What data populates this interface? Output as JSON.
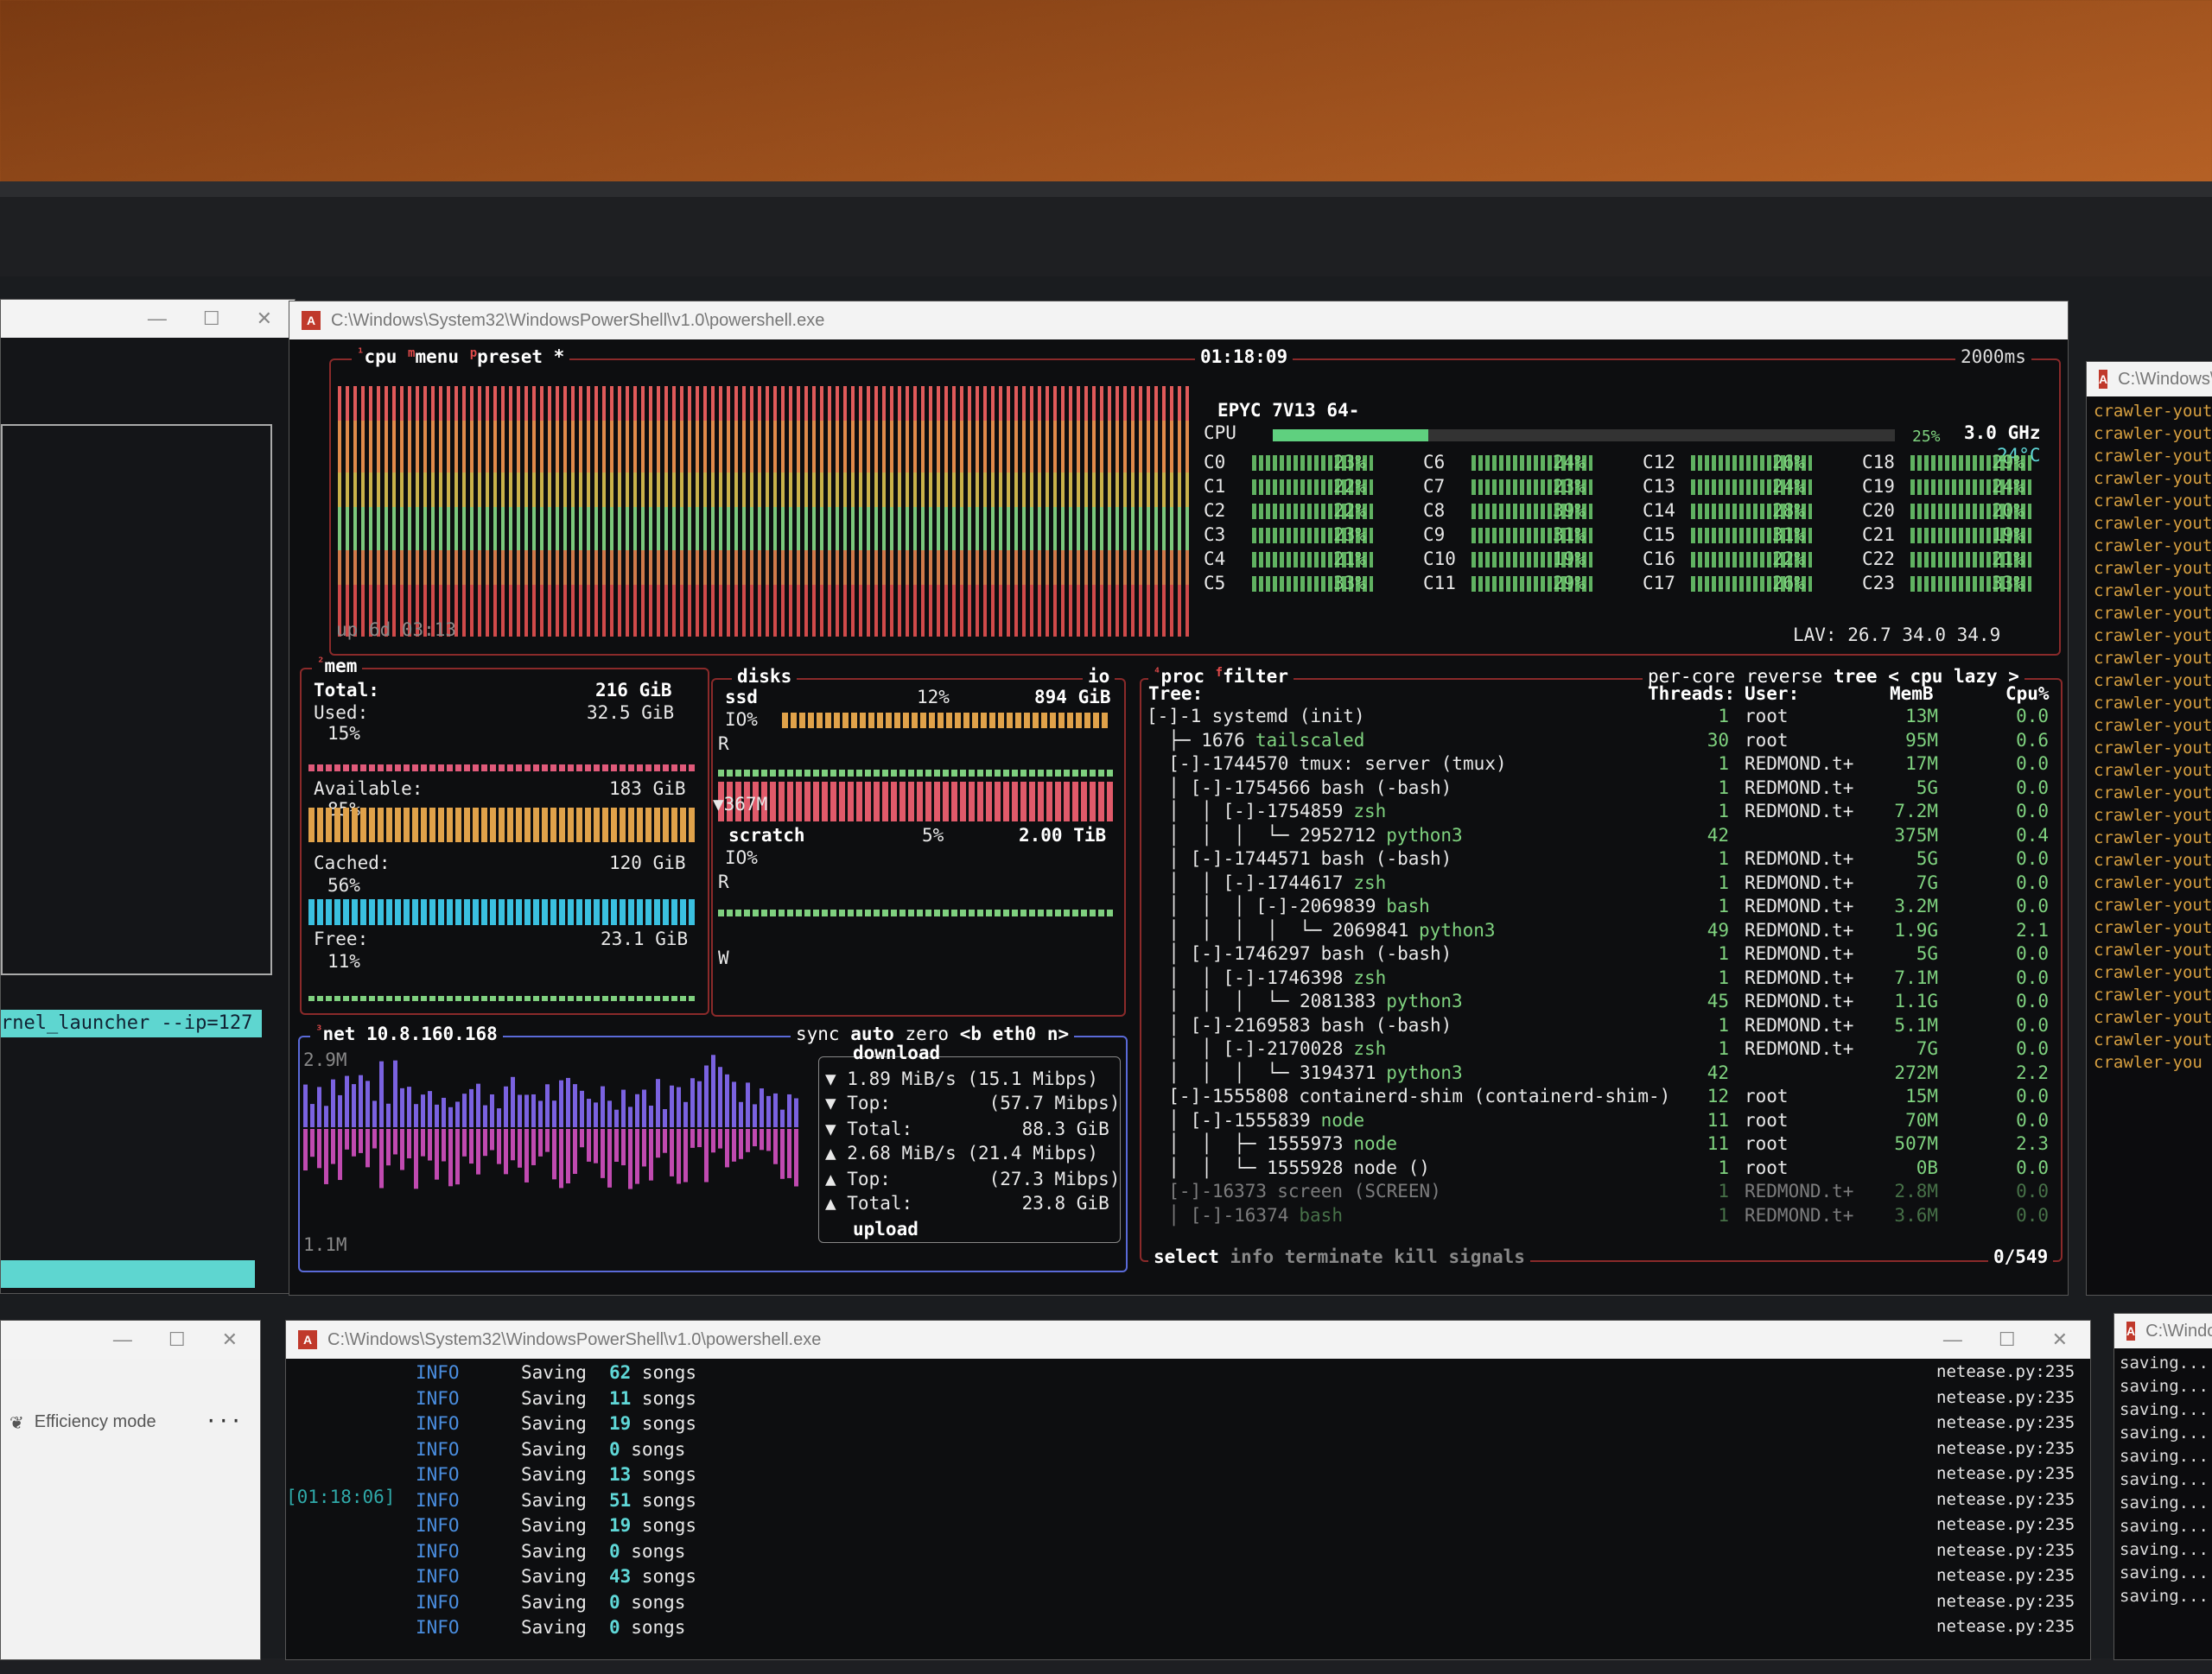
{
  "btop_window": {
    "title": "C:\\Windows\\System32\\WindowsPowerShell\\v1.0\\powershell.exe",
    "cpu_box": {
      "label": "cpu",
      "menu": "menu",
      "preset": "preset *",
      "clock": "01:18:09",
      "interval": "2000ms",
      "uptime": "up 6d 03:13",
      "model": "EPYC 7V13 64-",
      "cpu_label": "CPU",
      "total_pct": "25%",
      "freq": "3.0 GHz",
      "temp": "24°C",
      "cores": [
        {
          "n": "C0",
          "p": "23%"
        },
        {
          "n": "C1",
          "p": "22%"
        },
        {
          "n": "C2",
          "p": "22%"
        },
        {
          "n": "C3",
          "p": "23%"
        },
        {
          "n": "C4",
          "p": "21%"
        },
        {
          "n": "C5",
          "p": "33%"
        },
        {
          "n": "C6",
          "p": "24%"
        },
        {
          "n": "C7",
          "p": "23%"
        },
        {
          "n": "C8",
          "p": "39%"
        },
        {
          "n": "C9",
          "p": "31%"
        },
        {
          "n": "C10",
          "p": "19%"
        },
        {
          "n": "C11",
          "p": "29%"
        },
        {
          "n": "C12",
          "p": "26%"
        },
        {
          "n": "C13",
          "p": "24%"
        },
        {
          "n": "C14",
          "p": "28%"
        },
        {
          "n": "C15",
          "p": "31%"
        },
        {
          "n": "C16",
          "p": "22%"
        },
        {
          "n": "C17",
          "p": "26%"
        },
        {
          "n": "C18",
          "p": "29%"
        },
        {
          "n": "C19",
          "p": "24%"
        },
        {
          "n": "C20",
          "p": "20%"
        },
        {
          "n": "C21",
          "p": "19%"
        },
        {
          "n": "C22",
          "p": "21%"
        },
        {
          "n": "C23",
          "p": "33%"
        }
      ],
      "lav": "LAV: 26.7 34.0 34.9"
    },
    "mem_box": {
      "label": "mem",
      "total_l": "Total:",
      "total": "216 GiB",
      "used_l": "Used:",
      "used": "32.5 GiB",
      "used_pct": "15%",
      "avail_l": "Available:",
      "avail": "183 GiB",
      "avail_pct": "85%",
      "cached_l": "Cached:",
      "cached": "120 GiB",
      "cached_pct": "56%",
      "free_l": "Free:",
      "free": "23.1 GiB",
      "free_pct": "11%"
    },
    "disks_box": {
      "label": "disks",
      "io": "io",
      "ssd": "ssd",
      "ssd_pct": "12%",
      "ssd_size": "894 GiB",
      "io_l": "IO%",
      "r": "R",
      "ssd_note": "▼367M",
      "scratch": "scratch",
      "scratch_pct": "5%",
      "scratch_size": "2.00 TiB",
      "w": "W"
    },
    "net_box": {
      "label": "net",
      "ip": "10.8.160.168",
      "sync": "sync",
      "auto": "auto",
      "zero": "zero",
      "iface": "<b eth0 n>",
      "top_scale": "2.9M",
      "bot_scale": "1.1M",
      "download": "download",
      "dl_rate": "▼ 1.89 MiB/s (15.1 Mibps)",
      "dl_top": "▼ Top:         (57.7 Mibps)",
      "dl_total": "▼ Total:          88.3 GiB",
      "ul_rate": "▲ 2.68 MiB/s (21.4 Mibps)",
      "ul_top": "▲ Top:         (27.3 Mibps)",
      "ul_total": "▲ Total:          23.8 GiB",
      "upload": "upload"
    },
    "proc_box": {
      "label": "proc",
      "filter": "filter",
      "per_core": "per-core",
      "reverse": "reverse",
      "tree": "tree",
      "sort": "< cpu lazy >",
      "tree_hdr": "Tree:",
      "threads_hdr": "Threads:",
      "user_hdr": "User:",
      "mem_hdr": "MemB",
      "cpu_hdr": "Cpu%",
      "rows": [
        {
          "tree": "[-]-1 ",
          "name": "systemd (init)",
          "th": "1",
          "user": "root",
          "mem": "13M",
          "cpu": "0.0"
        },
        {
          "tree": "  ├─ 1676 ",
          "name": "tailscaled",
          "th": "30",
          "user": "root",
          "mem": "95M",
          "cpu": "0.6"
        },
        {
          "tree": "  [-]-1744570 ",
          "name": "tmux: server (tmux)",
          "th": "1",
          "user": "REDMOND.t+",
          "mem": "17M",
          "cpu": "0.0"
        },
        {
          "tree": "  │ [-]-1754566 ",
          "name": "bash (-bash)",
          "th": "1",
          "user": "REDMOND.t+",
          "mem": "5G",
          "cpu": "0.0"
        },
        {
          "tree": "  │  │ [-]-1754859 ",
          "name": "zsh",
          "th": "1",
          "user": "REDMOND.t+",
          "mem": "7.2M",
          "cpu": "0.0"
        },
        {
          "tree": "  │  │  │  └─ 2952712 ",
          "name": "python3",
          "th": "42",
          "user": "",
          "mem": "375M",
          "cpu": "0.4"
        },
        {
          "tree": "  │ [-]-1744571 ",
          "name": "bash (-bash)",
          "th": "1",
          "user": "REDMOND.t+",
          "mem": "5G",
          "cpu": "0.0"
        },
        {
          "tree": "  │  │ [-]-1744617 ",
          "name": "zsh",
          "th": "1",
          "user": "REDMOND.t+",
          "mem": "7G",
          "cpu": "0.0"
        },
        {
          "tree": "  │  │  │ [-]-2069839 ",
          "name": "bash",
          "th": "1",
          "user": "REDMOND.t+",
          "mem": "3.2M",
          "cpu": "0.0"
        },
        {
          "tree": "  │  │  │  │  └─ 2069841 ",
          "name": "python3",
          "th": "49",
          "user": "REDMOND.t+",
          "mem": "1.9G",
          "cpu": "2.1"
        },
        {
          "tree": "  │ [-]-1746297 ",
          "name": "bash (-bash)",
          "th": "1",
          "user": "REDMOND.t+",
          "mem": "5G",
          "cpu": "0.0"
        },
        {
          "tree": "  │  │ [-]-1746398 ",
          "name": "zsh",
          "th": "1",
          "user": "REDMOND.t+",
          "mem": "7.1M",
          "cpu": "0.0"
        },
        {
          "tree": "  │  │  │  └─ 2081383 ",
          "name": "python3",
          "th": "45",
          "user": "REDMOND.t+",
          "mem": "1.1G",
          "cpu": "0.0"
        },
        {
          "tree": "  │ [-]-2169583 ",
          "name": "bash (-bash)",
          "th": "1",
          "user": "REDMOND.t+",
          "mem": "5.1M",
          "cpu": "0.0"
        },
        {
          "tree": "  │  │ [-]-2170028 ",
          "name": "zsh",
          "th": "1",
          "user": "REDMOND.t+",
          "mem": "7G",
          "cpu": "0.0"
        },
        {
          "tree": "  │  │  │  └─ 3194371 ",
          "name": "python3",
          "th": "42",
          "user": "",
          "mem": "272M",
          "cpu": "2.2"
        },
        {
          "tree": "  [-]-1555808 ",
          "name": "containerd-shim (containerd-shim-)",
          "th": "12",
          "user": "root",
          "mem": "15M",
          "cpu": "0.0"
        },
        {
          "tree": "  │ [-]-1555839 ",
          "name": "node",
          "th": "11",
          "user": "root",
          "mem": "70M",
          "cpu": "0.0"
        },
        {
          "tree": "  │  │  ├─ 1555973 ",
          "name": "node",
          "th": "11",
          "user": "root",
          "mem": "507M",
          "cpu": "2.3"
        },
        {
          "tree": "  │  │  └─ 1555928 ",
          "name": "node ()",
          "th": "1",
          "user": "root",
          "mem": "0B",
          "cpu": "0.0"
        },
        {
          "tree": "  [-]-16373 ",
          "name": "screen (SCREEN)",
          "th": "1",
          "user": "REDMOND.t+",
          "mem": "2.8M",
          "cpu": "0.0"
        },
        {
          "tree": "  │ [-]-16374 ",
          "name": "bash",
          "th": "1",
          "user": "REDMOND.t+",
          "mem": "3.6M",
          "cpu": "0.0"
        }
      ],
      "footer": {
        "select": "select",
        "info": "info",
        "terminate": "terminate",
        "kill": "kill",
        "signals": "signals",
        "count": "0/549"
      }
    }
  },
  "bottom_window": {
    "title": "C:\\Windows\\System32\\WindowsPowerShell\\v1.0\\powershell.exe",
    "timestamp": "[01:18:06]",
    "log": [
      {
        "level": "INFO",
        "msg": "Saving ",
        "n": "62",
        "tail": " songs",
        "src": "netease.py:235"
      },
      {
        "level": "INFO",
        "msg": "Saving ",
        "n": "11",
        "tail": " songs",
        "src": "netease.py:235"
      },
      {
        "level": "INFO",
        "msg": "Saving ",
        "n": "19",
        "tail": " songs",
        "src": "netease.py:235"
      },
      {
        "level": "INFO",
        "msg": "Saving ",
        "n": "0",
        "tail": " songs",
        "src": "netease.py:235"
      },
      {
        "level": "INFO",
        "msg": "Saving ",
        "n": "13",
        "tail": " songs",
        "src": "netease.py:235"
      },
      {
        "level": "INFO",
        "msg": "Saving ",
        "n": "51",
        "tail": " songs",
        "src": "netease.py:235"
      },
      {
        "level": "INFO",
        "msg": "Saving ",
        "n": "19",
        "tail": " songs",
        "src": "netease.py:235"
      },
      {
        "level": "INFO",
        "msg": "Saving ",
        "n": "0",
        "tail": " songs",
        "src": "netease.py:235"
      },
      {
        "level": "INFO",
        "msg": "Saving ",
        "n": "43",
        "tail": " songs",
        "src": "netease.py:235"
      },
      {
        "level": "INFO",
        "msg": "Saving ",
        "n": "0",
        "tail": " songs",
        "src": "netease.py:235"
      },
      {
        "level": "INFO",
        "msg": "Saving ",
        "n": "0",
        "tail": " songs",
        "src": "netease.py:235"
      }
    ]
  },
  "left_window": {
    "cmd": "rnel_launcher --ip=127",
    "efficiency": "Efficiency mode",
    "more": "···"
  },
  "right_window": {
    "title": "C:\\Windows\\S",
    "lines": [
      "crawler-yout",
      "crawler-yout",
      "crawler-yout",
      "crawler-yout",
      "crawler-yout",
      "crawler-yout",
      "crawler-yout",
      "crawler-yout",
      "crawler-yout",
      "crawler-yout",
      "crawler-yout",
      "crawler-yout",
      "crawler-yout",
      "crawler-yout",
      "crawler-yout",
      "crawler-yout",
      "crawler-yout",
      "crawler-yout",
      "crawler-yout",
      "crawler-yout",
      "crawler-yout",
      "crawler-yout",
      "crawler-yout",
      "crawler-yout",
      "crawler-yout",
      "crawler-yout",
      "crawler-yout",
      "crawler-yout",
      "crawler-yout",
      "crawler-you"
    ]
  },
  "right_bottom_window": {
    "title": "C:\\Windo",
    "lines": [
      "saving...",
      "saving...",
      "saving...",
      "saving...",
      "saving...",
      "saving...",
      "saving...",
      "saving...",
      "saving...",
      "saving...",
      "saving..."
    ]
  }
}
